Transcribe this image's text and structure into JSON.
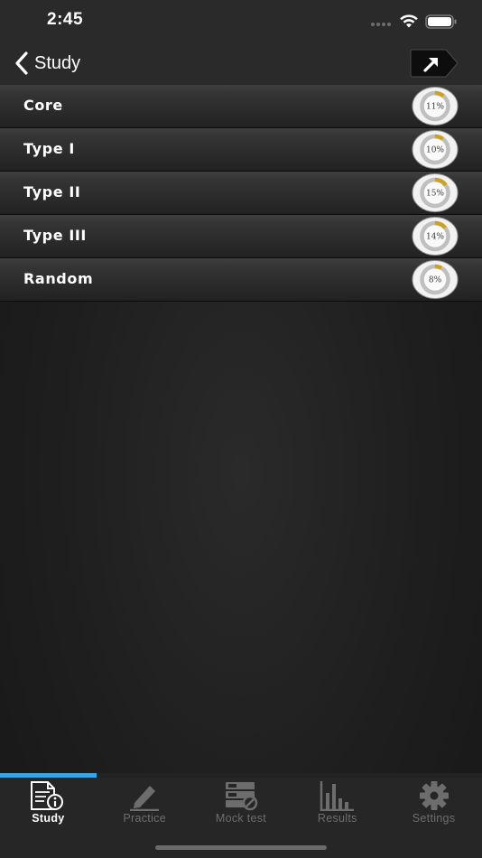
{
  "status_bar": {
    "time": "2:45"
  },
  "nav": {
    "back_label": "Study",
    "back_icon": "chevron-left-icon",
    "share_icon": "share-arrow-icon"
  },
  "items": [
    {
      "label": "Core",
      "percent_text": "11%",
      "progress": 0.11
    },
    {
      "label": "Type I",
      "percent_text": "10%",
      "progress": 0.1
    },
    {
      "label": "Type II",
      "percent_text": "15%",
      "progress": 0.15
    },
    {
      "label": "Type III",
      "percent_text": "14%",
      "progress": 0.14
    },
    {
      "label": "Random",
      "percent_text": "8%",
      "progress": 0.08
    }
  ],
  "tab_bar": {
    "active_index": 0,
    "tabs": [
      {
        "label": "Study",
        "icon": "document-info-icon"
      },
      {
        "label": "Practice",
        "icon": "pencil-icon"
      },
      {
        "label": "Mock test",
        "icon": "mock-test-icon"
      },
      {
        "label": "Results",
        "icon": "bar-chart-icon"
      },
      {
        "label": "Settings",
        "icon": "gear-icon"
      }
    ]
  },
  "colors": {
    "accent": "#3aa3e6",
    "ring_progress": "#c9a227",
    "ring_track": "#bfbfbf",
    "tab_inactive": "#6d6d6d",
    "tab_active": "#ffffff"
  }
}
